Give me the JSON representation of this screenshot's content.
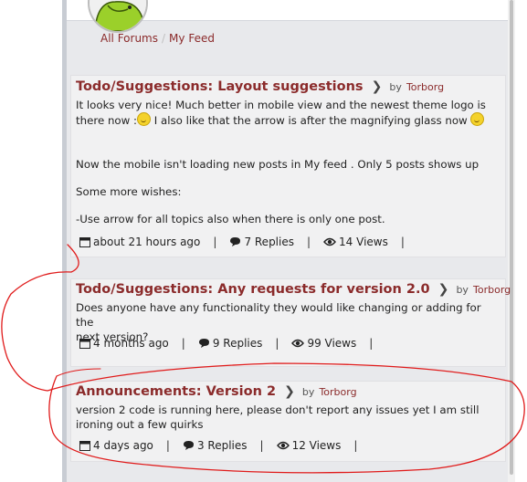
{
  "breadcrumb": {
    "items": [
      "All Forums",
      "My Feed"
    ],
    "separator": "/"
  },
  "posts": [
    {
      "category": "Todo/Suggestions:",
      "title": "Layout suggestions",
      "by_label": "by",
      "author": "Torborg",
      "body": [
        "It looks very nice! Much better in mobile view and the newest theme logo is",
        "there now :",
        " I also like that the arrow is after the magnifying glass now ",
        "Now the mobile isn't loading new posts in My feed . Only 5 posts shows up",
        "Some more wishes:",
        "-Use arrow for all topics also when there is only one post."
      ],
      "time": "about 21 hours ago",
      "replies": "7 Replies",
      "views": "14 Views"
    },
    {
      "category": "Todo/Suggestions:",
      "title": "Any requests for version 2.0",
      "by_label": "by",
      "author": "Torborg",
      "body": [
        "Does anyone have any functionality they would like changing or adding for the",
        "next version?"
      ],
      "time": "4 months ago",
      "replies": "9 Replies",
      "views": "99 Views"
    },
    {
      "category": "Announcements:",
      "title": "Version 2",
      "by_label": "by",
      "author": "Torborg",
      "body": [
        "version 2 code is running here, please don't report any issues yet I am still",
        "ironing out a few quirks"
      ],
      "time": "4 days ago",
      "replies": "3 Replies",
      "views": "12 Views"
    }
  ],
  "meta_separator": "|",
  "colors": {
    "link": "#8b2b2b",
    "annotation": "#e01b1b",
    "card_bg": "#f1f1f2",
    "page_bg": "#e8e9ec"
  }
}
